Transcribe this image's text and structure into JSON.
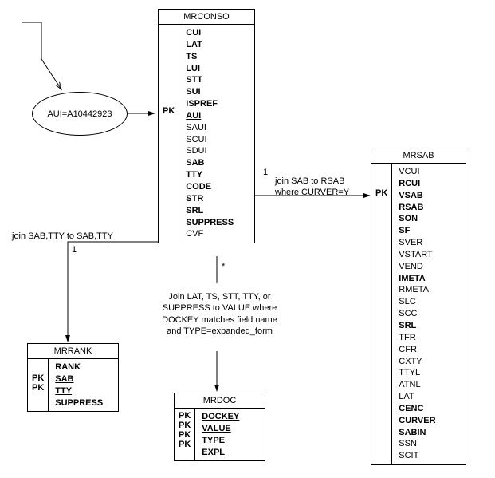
{
  "ellipse": {
    "text": "AUI=A10442923"
  },
  "mrconso": {
    "title": "MRCONSO",
    "pk": "PK",
    "fields": [
      {
        "name": "CUI",
        "bold": true
      },
      {
        "name": "LAT",
        "bold": true
      },
      {
        "name": "TS",
        "bold": true
      },
      {
        "name": "LUI",
        "bold": true
      },
      {
        "name": "STT",
        "bold": true
      },
      {
        "name": "SUI",
        "bold": true
      },
      {
        "name": "ISPREF",
        "bold": true
      },
      {
        "name": "AUI",
        "bold": true,
        "underline": true
      },
      {
        "name": "SAUI"
      },
      {
        "name": "SCUI"
      },
      {
        "name": "SDUI"
      },
      {
        "name": "SAB",
        "bold": true
      },
      {
        "name": "TTY",
        "bold": true
      },
      {
        "name": "CODE",
        "bold": true
      },
      {
        "name": "STR",
        "bold": true
      },
      {
        "name": "SRL",
        "bold": true
      },
      {
        "name": "SUPPRESS",
        "bold": true
      },
      {
        "name": "CVF"
      }
    ]
  },
  "mrsab": {
    "title": "MRSAB",
    "pk": "PK",
    "fields": [
      {
        "name": "VCUI"
      },
      {
        "name": "RCUI",
        "bold": true
      },
      {
        "name": "VSAB",
        "bold": true,
        "underline": true
      },
      {
        "name": "RSAB",
        "bold": true
      },
      {
        "name": "SON",
        "bold": true
      },
      {
        "name": "SF",
        "bold": true
      },
      {
        "name": "SVER"
      },
      {
        "name": "VSTART"
      },
      {
        "name": "VEND"
      },
      {
        "name": "IMETA",
        "bold": true
      },
      {
        "name": "RMETA"
      },
      {
        "name": "SLC"
      },
      {
        "name": "SCC"
      },
      {
        "name": "SRL",
        "bold": true
      },
      {
        "name": "TFR"
      },
      {
        "name": "CFR"
      },
      {
        "name": "CXTY"
      },
      {
        "name": "TTYL"
      },
      {
        "name": "ATNL"
      },
      {
        "name": "LAT"
      },
      {
        "name": "CENC",
        "bold": true
      },
      {
        "name": "CURVER",
        "bold": true
      },
      {
        "name": "SABIN",
        "bold": true
      },
      {
        "name": "SSN"
      },
      {
        "name": "SCIT"
      }
    ]
  },
  "mrrank": {
    "title": "MRRANK",
    "pk": [
      "PK",
      "PK"
    ],
    "fields": [
      {
        "name": "RANK",
        "bold": true
      },
      {
        "name": "SAB",
        "bold": true,
        "underline": true
      },
      {
        "name": "TTY",
        "bold": true,
        "underline": true
      },
      {
        "name": "SUPPRESS",
        "bold": true
      }
    ]
  },
  "mrdoc": {
    "title": "MRDOC",
    "pk": [
      "PK",
      "PK",
      "PK",
      "PK"
    ],
    "fields": [
      {
        "name": "DOCKEY",
        "bold": true,
        "underline": true
      },
      {
        "name": "VALUE",
        "bold": true,
        "underline": true
      },
      {
        "name": "TYPE",
        "bold": true,
        "underline": true
      },
      {
        "name": "EXPL",
        "bold": true,
        "underline": true
      }
    ]
  },
  "labels": {
    "join_sab_tty": "join SAB,TTY to SAB,TTY",
    "join_sab_rsab_1": "join SAB to RSAB",
    "join_sab_rsab_2": "where CURVER=Y",
    "join_doc_1": "Join LAT, TS, STT, TTY, or",
    "join_doc_2": "SUPPRESS to VALUE where",
    "join_doc_3": "DOCKEY matches field name",
    "join_doc_4": "and TYPE=expanded_form",
    "card_1a": "1",
    "card_1b": "1",
    "card_star": "*"
  }
}
